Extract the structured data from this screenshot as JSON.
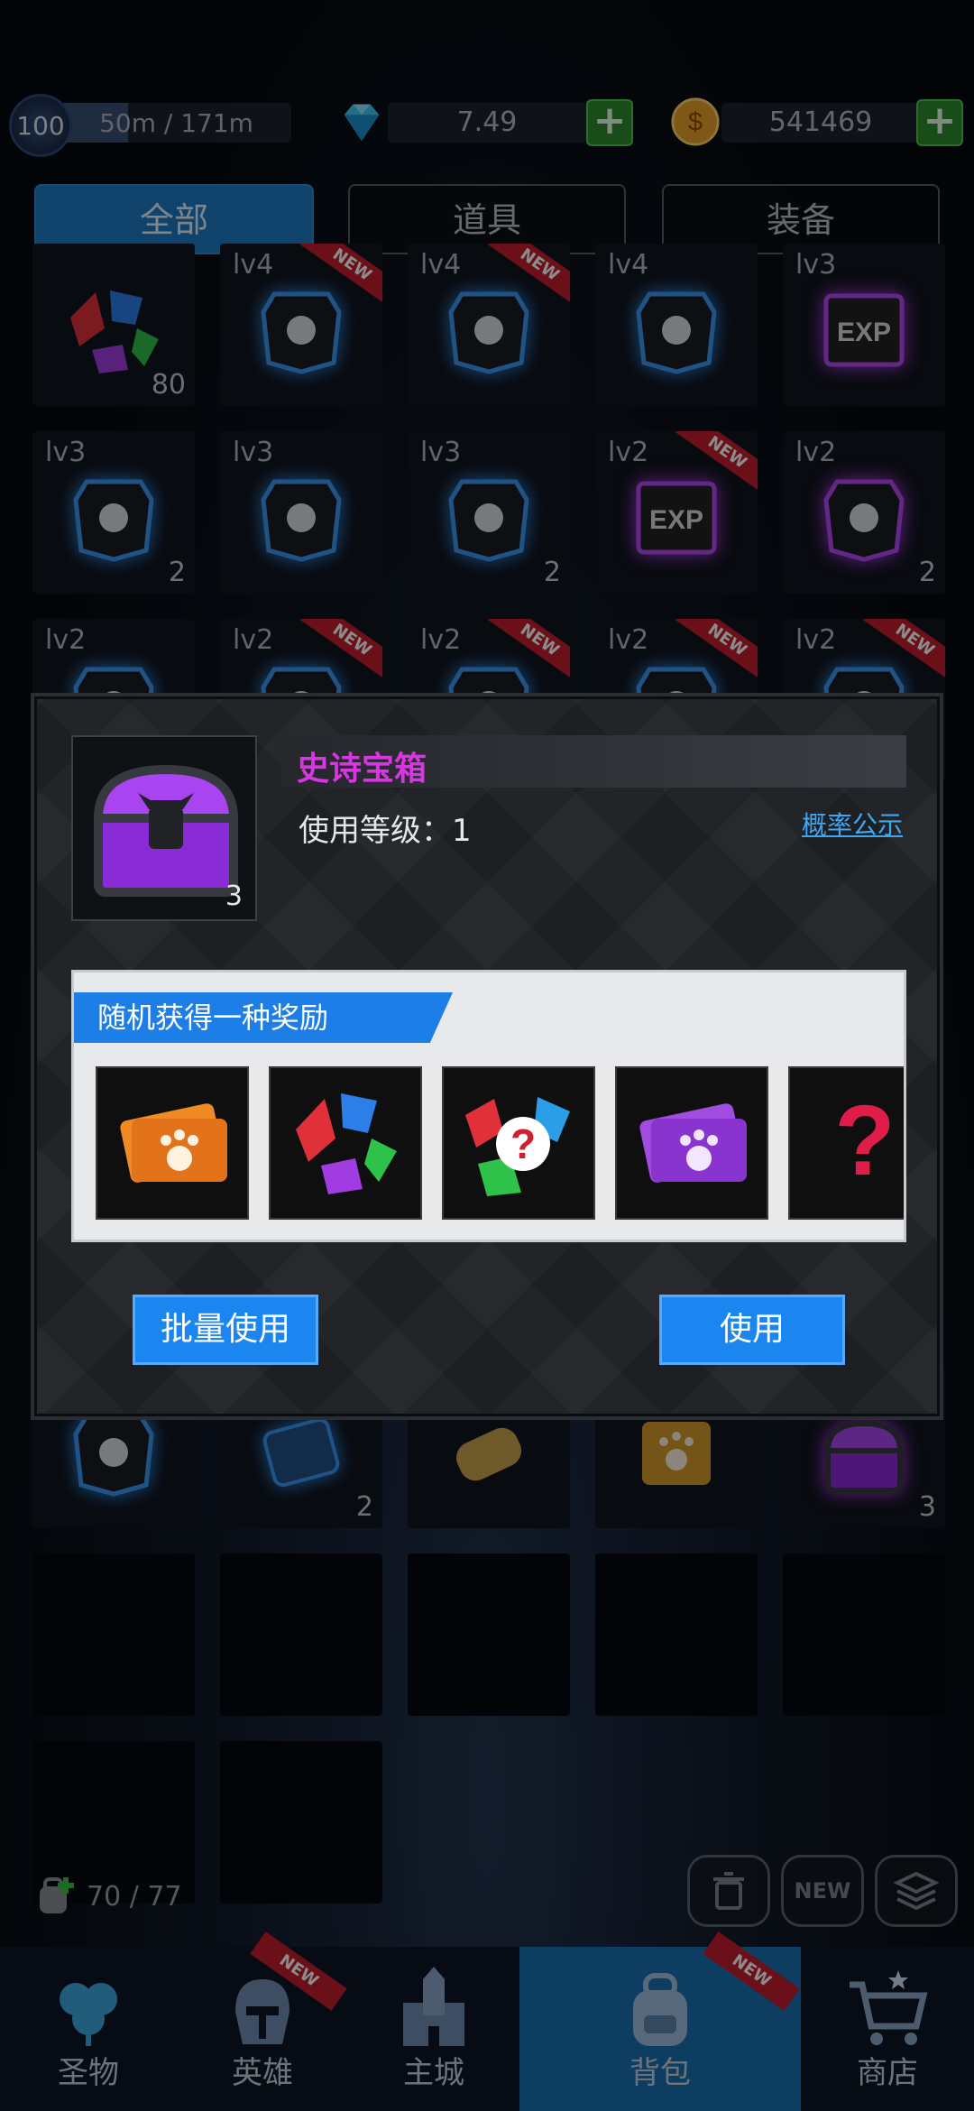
{
  "topbar": {
    "level": "100",
    "distance": "50m / 171m",
    "distance_progress": 0.29,
    "gems": "7.49",
    "gold": "541469"
  },
  "tabs": [
    {
      "label": "全部",
      "active": true
    },
    {
      "label": "道具",
      "active": false
    },
    {
      "label": "装备",
      "active": false
    }
  ],
  "grid": {
    "row1": [
      {
        "lv": "",
        "count": "80",
        "new": false,
        "art": "gem-cluster-icon"
      },
      {
        "lv": "lv4",
        "count": "",
        "new": true,
        "art": "sword-rune-icon"
      },
      {
        "lv": "lv4",
        "count": "",
        "new": true,
        "art": "shield-rune-icon"
      },
      {
        "lv": "lv4",
        "count": "",
        "new": false,
        "art": "heart-rune-icon"
      },
      {
        "lv": "lv3",
        "count": "",
        "new": false,
        "art": "exp-card-icon"
      }
    ],
    "row2": [
      {
        "lv": "lv3",
        "count": "2",
        "new": false,
        "art": "skull-rune-icon"
      },
      {
        "lv": "lv3",
        "count": "",
        "new": false,
        "art": "broken-shield-rune-icon"
      },
      {
        "lv": "lv3",
        "count": "2",
        "new": false,
        "art": "shield-exclaim-rune-icon"
      },
      {
        "lv": "lv2",
        "count": "",
        "new": true,
        "art": "exp-card-icon"
      },
      {
        "lv": "lv2",
        "count": "2",
        "new": false,
        "art": "clover-rune-icon"
      }
    ],
    "row3": [
      {
        "lv": "lv2",
        "count": "",
        "new": false,
        "art": "coin-rune-icon"
      },
      {
        "lv": "lv2",
        "count": "",
        "new": true,
        "art": "rune-icon"
      },
      {
        "lv": "lv2",
        "count": "",
        "new": true,
        "art": "rune-icon"
      },
      {
        "lv": "lv2",
        "count": "",
        "new": true,
        "art": "rune-icon"
      },
      {
        "lv": "lv2",
        "count": "",
        "new": true,
        "art": "rune-icon"
      }
    ],
    "row4": [
      {
        "lv": "",
        "count": "",
        "new": false,
        "art": "fist-rune-icon"
      },
      {
        "lv": "",
        "count": "2",
        "new": false,
        "art": "map-scroll-icon"
      },
      {
        "lv": "",
        "count": "",
        "new": false,
        "art": "bell-scroll-icon"
      },
      {
        "lv": "",
        "count": "",
        "new": false,
        "art": "paw-ticket-icon"
      },
      {
        "lv": "",
        "count": "3",
        "new": false,
        "art": "epic-chest-icon"
      }
    ]
  },
  "bag": {
    "count": "70 / 77"
  },
  "actions": {
    "new_label": "NEW"
  },
  "modal": {
    "item_name": "史诗宝箱",
    "item_count": "3",
    "use_level": "使用等级：1",
    "prob_link": "概率公示",
    "reward_title": "随机获得一种奖励",
    "rewards": [
      "orange-paw-ticket-icon",
      "gem-cluster-icon",
      "random-gem-icon",
      "purple-paw-ticket-icon",
      "mystery-icon"
    ],
    "batch_use": "批量使用",
    "use": "使用"
  },
  "nav": [
    {
      "label": "圣物",
      "new": false,
      "active": false
    },
    {
      "label": "英雄",
      "new": true,
      "active": false
    },
    {
      "label": "主城",
      "new": false,
      "active": false
    },
    {
      "label": "背包",
      "new": true,
      "active": true
    },
    {
      "label": "商店",
      "new": false,
      "active": false
    }
  ],
  "badge_text": "NEW"
}
